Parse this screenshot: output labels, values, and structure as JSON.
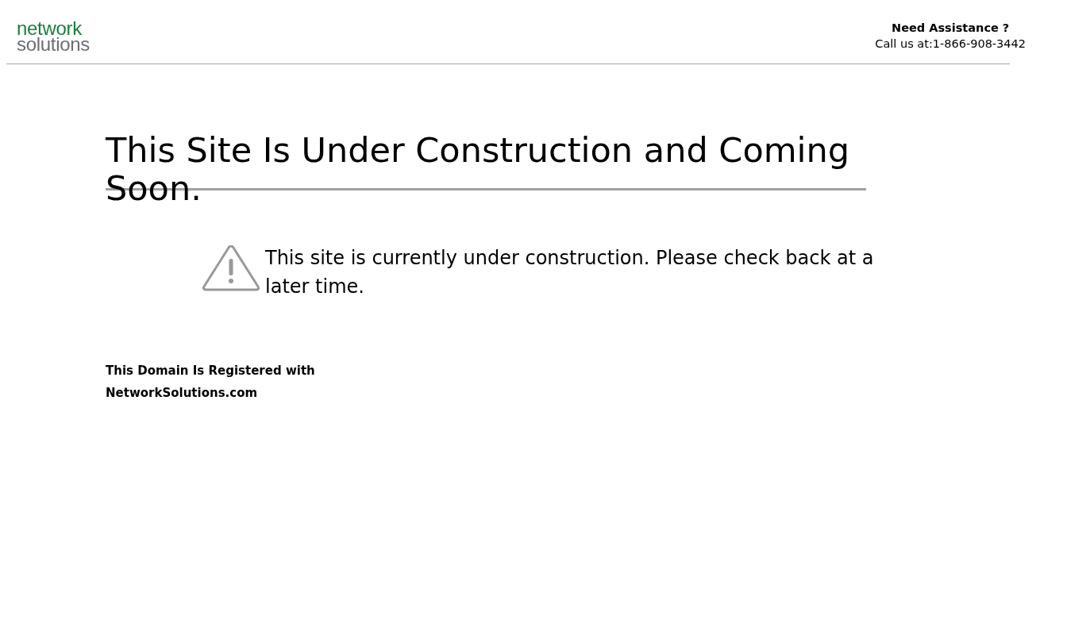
{
  "header": {
    "logo": {
      "line_1": "network",
      "line_2": "solutions"
    },
    "assistance": {
      "title": "Need Assistance ?",
      "phone": "Call us at:1-866-908-3442"
    }
  },
  "title": "This Site Is Under Construction and Coming Soon.",
  "notice": {
    "message": "This site is currently under construction. Please check back at a later time."
  },
  "footer": {
    "line_1": "This Domain Is Registered with",
    "line_2": "NetworkSolutions.com"
  }
}
